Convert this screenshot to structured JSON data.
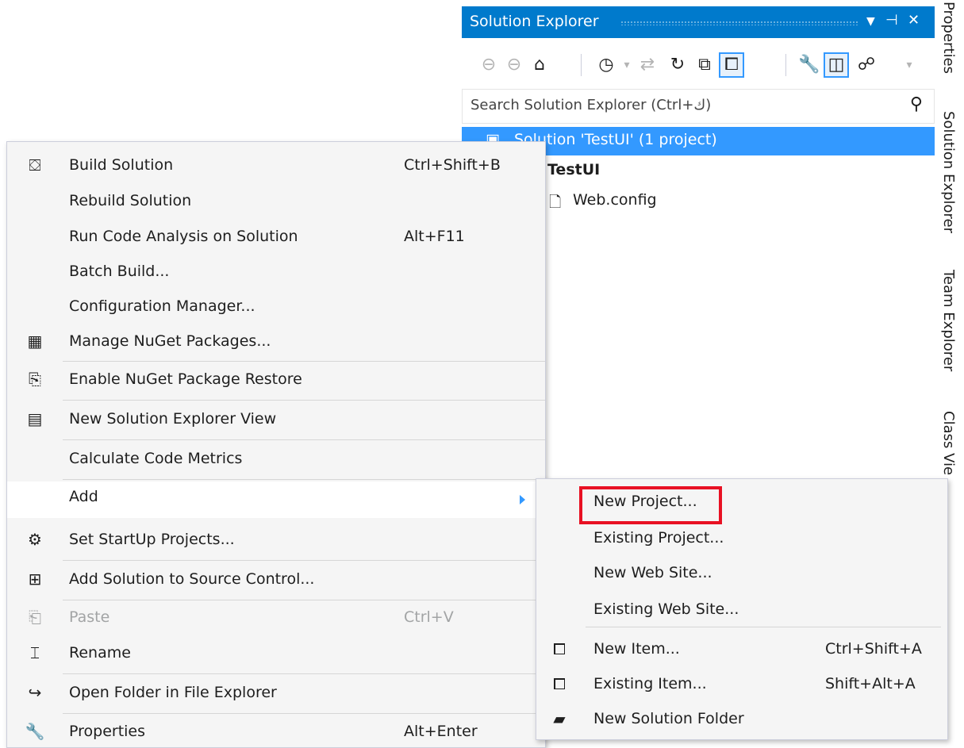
{
  "solution_explorer": {
    "title": "Solution Explorer",
    "controls": {
      "dropdown": "▼",
      "pin": "⊣",
      "close": "✕"
    },
    "toolbar_icons": [
      "back-icon",
      "forward-icon",
      "home-icon",
      "history-icon",
      "dropdown-arrow-icon",
      "sync-icon",
      "refresh-icon",
      "collapse-all-icon",
      "show-all-files-icon",
      "properties-wrench-icon",
      "preview-selected-icon",
      "class-diagram-icon",
      "toolbar-dropdown-icon"
    ],
    "search": {
      "placeholder": "Search Solution Explorer (Ctrl+ك)"
    },
    "tree": [
      {
        "label": "Solution 'TestUI' (1 project)",
        "selected": true
      },
      {
        "label": "TestUI",
        "selected": false
      },
      {
        "label": "Web.config",
        "selected": false
      }
    ]
  },
  "side_tabs": [
    "Properties",
    "Solution Explorer",
    "Team Explorer",
    "Class Vie"
  ],
  "context_menu": {
    "items": [
      {
        "icon": "build-solution-icon",
        "label": "Build Solution",
        "shortcut": "Ctrl+Shift+B"
      },
      {
        "icon": "",
        "label": "Rebuild Solution",
        "shortcut": ""
      },
      {
        "icon": "",
        "label": "Run Code Analysis on Solution",
        "shortcut": "Alt+F11"
      },
      {
        "icon": "",
        "label": "Batch Build...",
        "shortcut": ""
      },
      {
        "icon": "",
        "label": "Configuration Manager...",
        "shortcut": ""
      },
      {
        "icon": "nuget-package-icon",
        "label": "Manage NuGet Packages...",
        "shortcut": ""
      },
      {
        "icon": "package-restore-icon",
        "label": "Enable NuGet Package Restore",
        "shortcut": ""
      },
      {
        "icon": "new-explorer-view-icon",
        "label": "New Solution Explorer View",
        "shortcut": ""
      },
      {
        "icon": "",
        "label": "Calculate Code Metrics",
        "shortcut": ""
      },
      {
        "icon": "",
        "label": "Add",
        "shortcut": ""
      },
      {
        "icon": "gear-icon",
        "label": "Set StartUp Projects...",
        "shortcut": ""
      },
      {
        "icon": "source-control-icon",
        "label": "Add Solution to Source Control...",
        "shortcut": ""
      },
      {
        "icon": "paste-icon",
        "label": "Paste",
        "shortcut": "Ctrl+V"
      },
      {
        "icon": "rename-icon",
        "label": "Rename",
        "shortcut": ""
      },
      {
        "icon": "open-folder-icon",
        "label": "Open Folder in File Explorer",
        "shortcut": ""
      },
      {
        "icon": "wrench-icon",
        "label": "Properties",
        "shortcut": "Alt+Enter"
      }
    ]
  },
  "add_submenu": {
    "items": [
      {
        "icon": "",
        "label": "New Project...",
        "shortcut": ""
      },
      {
        "icon": "",
        "label": "Existing Project...",
        "shortcut": ""
      },
      {
        "icon": "",
        "label": "New Web Site...",
        "shortcut": ""
      },
      {
        "icon": "",
        "label": "Existing Web Site...",
        "shortcut": ""
      },
      {
        "icon": "new-item-icon",
        "label": "New Item...",
        "shortcut": "Ctrl+Shift+A"
      },
      {
        "icon": "existing-item-icon",
        "label": "Existing Item...",
        "shortcut": "Shift+Alt+A"
      },
      {
        "icon": "new-solution-folder-icon",
        "label": "New Solution Folder",
        "shortcut": ""
      }
    ]
  },
  "highlight_color": "#e81123",
  "accent_color": "#007acc"
}
